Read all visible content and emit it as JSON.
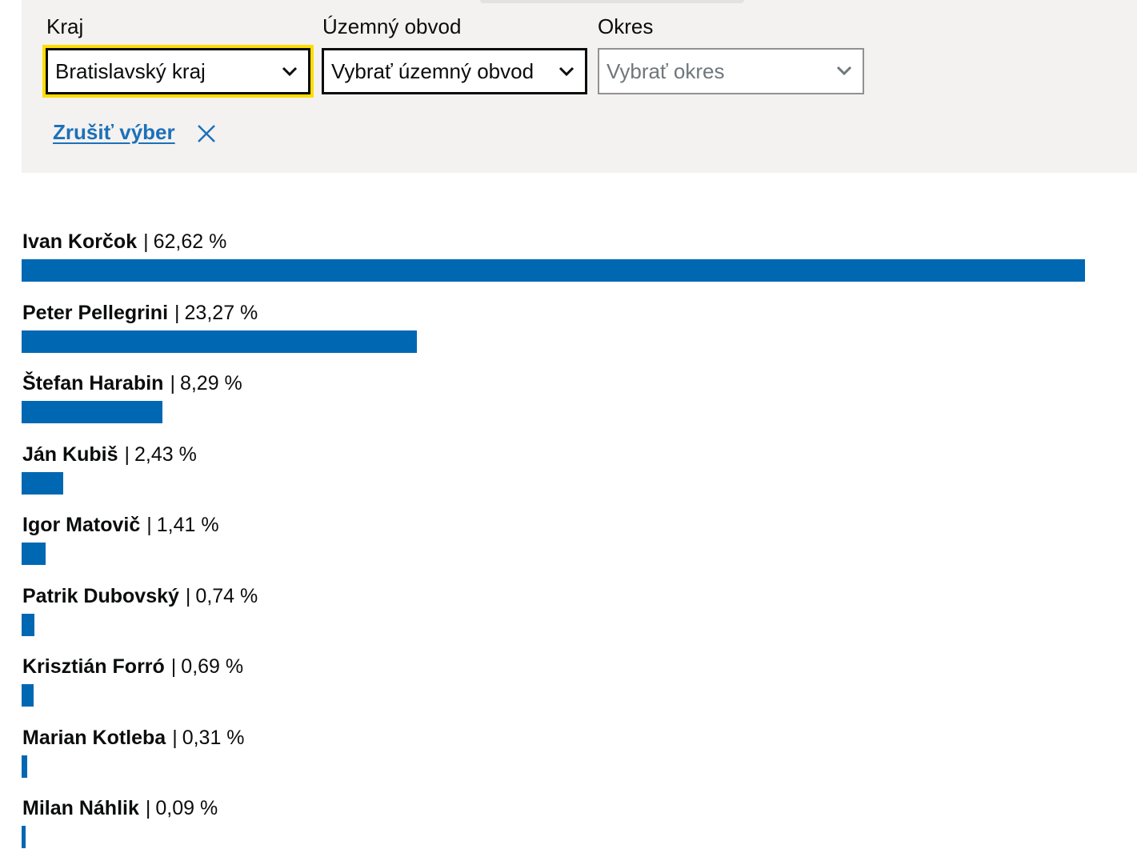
{
  "filters": {
    "kraj": {
      "label": "Kraj",
      "value": "Bratislavský kraj"
    },
    "uzemny_obvod": {
      "label": "Územný obvod",
      "value": "Vybrať územný obvod"
    },
    "okres": {
      "label": "Okres",
      "value": "Vybrať okres"
    },
    "clear_label": "Zrušiť výber"
  },
  "colors": {
    "bar": "#0067b3",
    "link": "#1d70b8",
    "focus": "#ffdd00",
    "panel": "#f3f2f1"
  },
  "icons": {
    "dropdown": "chevron-down-icon",
    "clear": "close-icon"
  },
  "chart_data": {
    "type": "bar",
    "orientation": "horizontal",
    "max_value": 62.62,
    "candidates": [
      {
        "name": "Ivan Korčok",
        "percent_label": "62,62 %",
        "value": 62.62
      },
      {
        "name": "Peter Pellegrini",
        "percent_label": "23,27 %",
        "value": 23.27
      },
      {
        "name": "Štefan Harabin",
        "percent_label": "8,29 %",
        "value": 8.29
      },
      {
        "name": "Ján Kubiš",
        "percent_label": "2,43 %",
        "value": 2.43
      },
      {
        "name": "Igor Matovič",
        "percent_label": "1,41 %",
        "value": 1.41
      },
      {
        "name": "Patrik Dubovský",
        "percent_label": "0,74 %",
        "value": 0.74
      },
      {
        "name": "Krisztián Forró",
        "percent_label": "0,69 %",
        "value": 0.69
      },
      {
        "name": "Marian Kotleba",
        "percent_label": "0,31 %",
        "value": 0.31
      },
      {
        "name": "Milan Náhlik",
        "percent_label": "0,09 %",
        "value": 0.09
      }
    ]
  }
}
